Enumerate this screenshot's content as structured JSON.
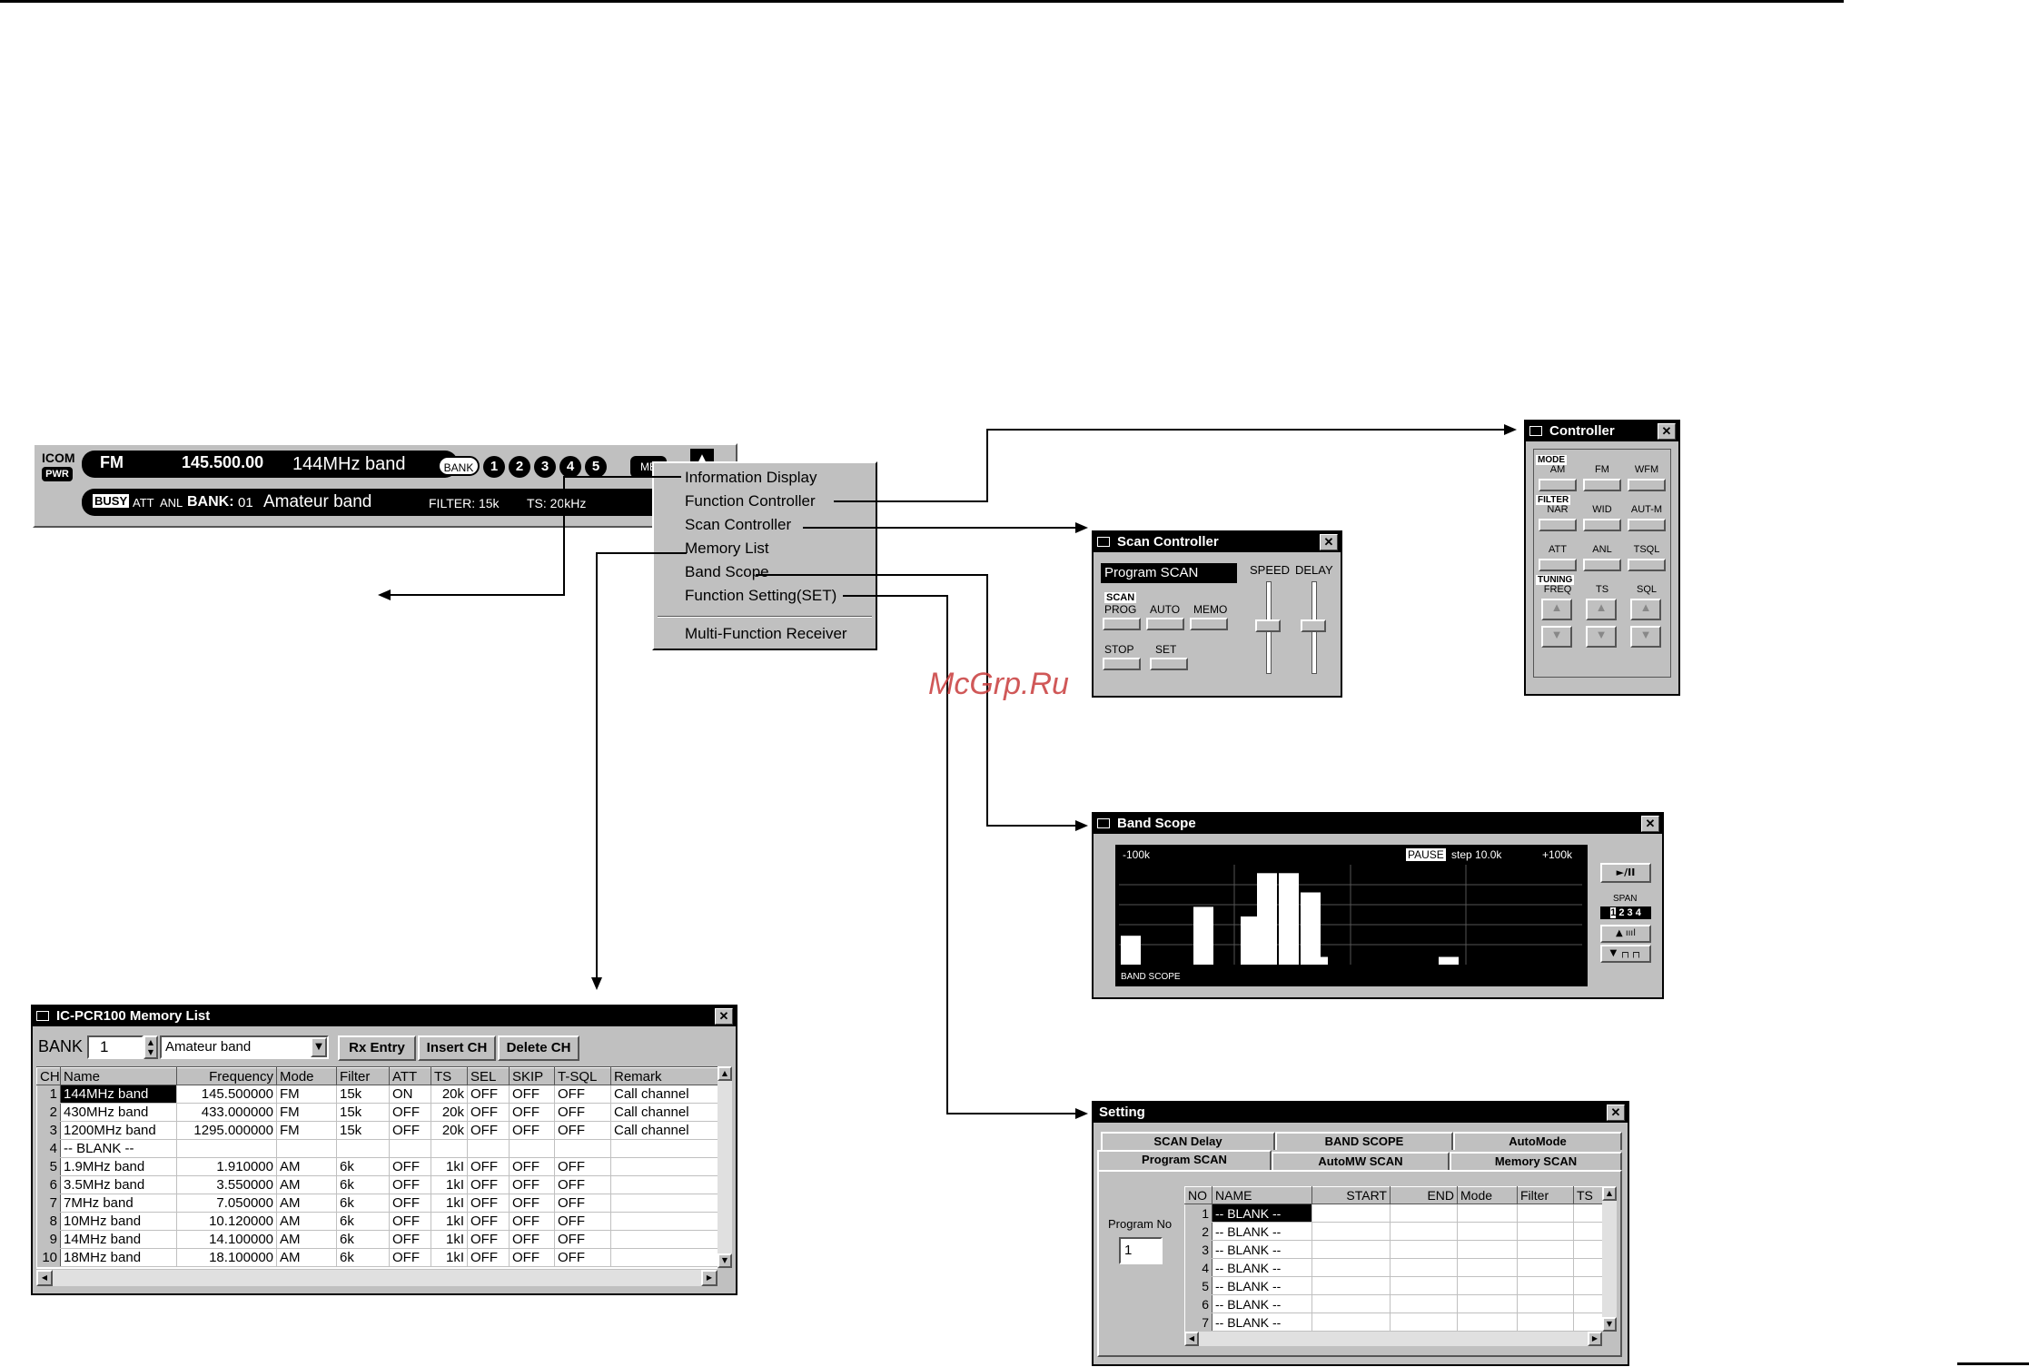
{
  "main_bar": {
    "logo": "ICOM",
    "pwr": "PWR",
    "mode": "FM",
    "frequency": "145.500.00",
    "band_name": "144MHz band",
    "bank_button": "BANK",
    "bank_numbers": [
      "1",
      "2",
      "3",
      "4",
      "5"
    ],
    "menu_button": "ME",
    "busy": "BUSY",
    "att": "ATT",
    "anl": "ANL",
    "bank_label": "BANK:",
    "bank_value": "01",
    "bank_name": "Amateur band",
    "filter": "FILTER: 15k",
    "ts": "TS: 20kHz"
  },
  "popup_menu": {
    "items": [
      "Information Display",
      "Function Controller",
      "Scan Controller",
      "Memory List",
      "Band Scope",
      "Function Setting(SET)",
      "Multi-Function Receiver"
    ]
  },
  "watermark": "McGrp.Ru",
  "controller": {
    "title": "Controller",
    "mode_label": "MODE",
    "mode_buttons": [
      "AM",
      "FM",
      "WFM"
    ],
    "filter_label": "FILTER",
    "filter_buttons": [
      "NAR",
      "WID",
      "AUT-M"
    ],
    "misc_buttons": [
      "ATT",
      "ANL",
      "TSQL"
    ],
    "tuning_label": "TUNING",
    "tuning_labels": [
      "FREQ",
      "TS",
      "SQL"
    ]
  },
  "scan_controller": {
    "title": "Scan Controller",
    "program": "Program SCAN",
    "speed": "SPEED",
    "delay": "DELAY",
    "scan_label": "SCAN",
    "buttons": [
      "PROG",
      "AUTO",
      "MEMO",
      "STOP",
      "SET"
    ]
  },
  "band_scope": {
    "title": "Band Scope",
    "left": "-100k",
    "pause": "PAUSE",
    "step": "step 10.0k",
    "right": "+100k",
    "footer": "BAND SCOPE",
    "play": "►/II",
    "span_label": "SPAN",
    "span_values": [
      "1",
      "2",
      "3",
      "4"
    ],
    "bars": [
      0.3,
      0,
      0.6,
      0,
      0.5,
      0.95,
      0.95,
      0.75,
      0.08,
      0.08
    ]
  },
  "memory_list": {
    "title": "IC-PCR100 Memory List",
    "bank_label": "BANK",
    "bank_value": "1",
    "bank_select": "Amateur band",
    "buttons": [
      "Rx Entry",
      "Insert CH",
      "Delete CH"
    ],
    "columns": [
      "CH",
      "Name",
      "Frequency",
      "Mode",
      "Filter",
      "ATT",
      "TS",
      "SEL",
      "SKIP",
      "T-SQL",
      "Remark"
    ],
    "rows": [
      [
        "1",
        "144MHz band",
        "145.500000",
        "FM",
        "15k",
        "ON",
        "20k",
        "OFF",
        "OFF",
        "OFF",
        "Call channel"
      ],
      [
        "2",
        "430MHz band",
        "433.000000",
        "FM",
        "15k",
        "OFF",
        "20k",
        "OFF",
        "OFF",
        "OFF",
        "Call channel"
      ],
      [
        "3",
        "1200MHz band",
        "1295.000000",
        "FM",
        "15k",
        "OFF",
        "20k",
        "OFF",
        "OFF",
        "OFF",
        "Call channel"
      ],
      [
        "4",
        "-- BLANK --",
        "",
        "",
        "",
        "",
        "",
        "",
        "",
        "",
        ""
      ],
      [
        "5",
        "1.9MHz band",
        "1.910000",
        "AM",
        "6k",
        "OFF",
        "1kI",
        "OFF",
        "OFF",
        "OFF",
        ""
      ],
      [
        "6",
        "3.5MHz band",
        "3.550000",
        "AM",
        "6k",
        "OFF",
        "1kI",
        "OFF",
        "OFF",
        "OFF",
        ""
      ],
      [
        "7",
        "7MHz band",
        "7.050000",
        "AM",
        "6k",
        "OFF",
        "1kI",
        "OFF",
        "OFF",
        "OFF",
        ""
      ],
      [
        "8",
        "10MHz band",
        "10.120000",
        "AM",
        "6k",
        "OFF",
        "1kI",
        "OFF",
        "OFF",
        "OFF",
        ""
      ],
      [
        "9",
        "14MHz band",
        "14.100000",
        "AM",
        "6k",
        "OFF",
        "1kI",
        "OFF",
        "OFF",
        "OFF",
        ""
      ],
      [
        "10",
        "18MHz band",
        "18.100000",
        "AM",
        "6k",
        "OFF",
        "1kI",
        "OFF",
        "OFF",
        "OFF",
        ""
      ]
    ]
  },
  "setting": {
    "title": "Setting",
    "tabs_row1": [
      "SCAN Delay",
      "BAND SCOPE",
      "AutoMode"
    ],
    "tabs_row2": [
      "Program SCAN",
      "AutoMW SCAN",
      "Memory SCAN"
    ],
    "program_no_label": "Program No",
    "program_no": "1",
    "columns": [
      "NO",
      "NAME",
      "START",
      "END",
      "Mode",
      "Filter",
      "TS"
    ],
    "rows": [
      [
        "1",
        "-- BLANK --"
      ],
      [
        "2",
        "-- BLANK --"
      ],
      [
        "3",
        "-- BLANK --"
      ],
      [
        "4",
        "-- BLANK --"
      ],
      [
        "5",
        "-- BLANK --"
      ],
      [
        "6",
        "-- BLANK --"
      ],
      [
        "7",
        "-- BLANK --"
      ]
    ]
  }
}
